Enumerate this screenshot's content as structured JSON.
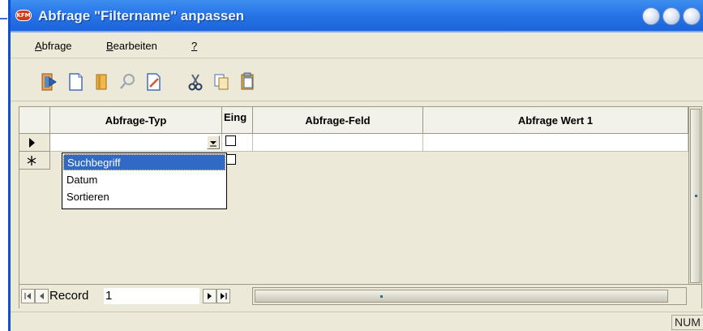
{
  "window": {
    "title": "Abfrage \"Filtername\" anpassen",
    "app_icon_text": "KFM"
  },
  "menu": {
    "items": [
      {
        "name": "menu-abfrage",
        "first": "A",
        "rest": "bfrage"
      },
      {
        "name": "menu-bearbeiten",
        "first": "B",
        "rest": "earbeiten"
      },
      {
        "name": "menu-help",
        "first": "?",
        "rest": ""
      }
    ]
  },
  "toolbar": {
    "icons": [
      "exit-icon",
      "new-document-icon",
      "open-book-icon",
      "search-icon",
      "edit-document-icon",
      "cut-icon",
      "copy-icon",
      "paste-icon"
    ]
  },
  "grid": {
    "columns": {
      "typ": "Abfrage-Typ",
      "eing": "Eing",
      "feld": "Abfrage-Feld",
      "wert": "Abfrage Wert 1"
    },
    "rows": [
      {
        "selector": "current-record",
        "typ_value": "",
        "eing_checked": false
      },
      {
        "selector": "new-record",
        "typ_value": "",
        "eing_checked": false
      }
    ]
  },
  "dropdown": {
    "options": [
      "Suchbegriff",
      "Datum",
      "Sortieren"
    ],
    "selected": "Suchbegriff"
  },
  "navigation": {
    "label": "Record",
    "current": "1"
  },
  "status": {
    "num": "NUM"
  },
  "colors": {
    "titlebar": "#2a78ea",
    "selection": "#316ac5",
    "chrome": "#ece9d8"
  }
}
